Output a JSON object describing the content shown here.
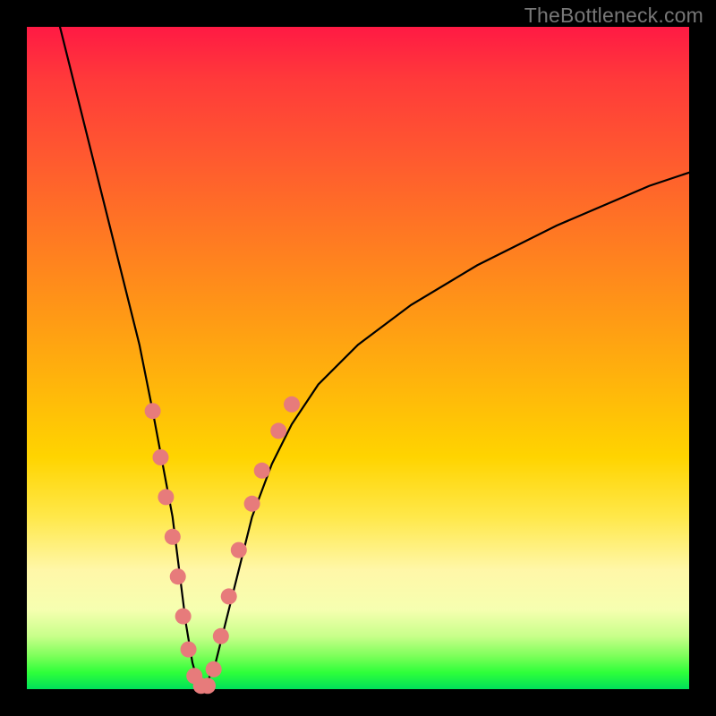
{
  "watermark": "TheBottleneck.com",
  "chart_data": {
    "type": "line",
    "title": "",
    "xlabel": "",
    "ylabel": "",
    "xlim": [
      0,
      100
    ],
    "ylim": [
      0,
      100
    ],
    "series": [
      {
        "name": "curve",
        "x": [
          5,
          8,
          11,
          14,
          17,
          19,
          20.5,
          22,
          23,
          24,
          25,
          26,
          27,
          28.5,
          30,
          32,
          34,
          37,
          40,
          44,
          50,
          58,
          68,
          80,
          94,
          100
        ],
        "y": [
          100,
          88,
          76,
          64,
          52,
          42,
          34,
          26,
          18,
          10,
          4,
          0.5,
          0.5,
          4,
          10,
          18,
          26,
          34,
          40,
          46,
          52,
          58,
          64,
          70,
          76,
          78
        ]
      }
    ],
    "markers": [
      {
        "name": "dots",
        "color": "#e77b7b",
        "radius_px": 9,
        "points": [
          {
            "x": 19.0,
            "y": 42
          },
          {
            "x": 20.2,
            "y": 35
          },
          {
            "x": 21.0,
            "y": 29
          },
          {
            "x": 22.0,
            "y": 23
          },
          {
            "x": 22.8,
            "y": 17
          },
          {
            "x": 23.6,
            "y": 11
          },
          {
            "x": 24.4,
            "y": 6
          },
          {
            "x": 25.3,
            "y": 2
          },
          {
            "x": 26.3,
            "y": 0.5
          },
          {
            "x": 27.3,
            "y": 0.5
          },
          {
            "x": 28.2,
            "y": 3
          },
          {
            "x": 29.3,
            "y": 8
          },
          {
            "x": 30.5,
            "y": 14
          },
          {
            "x": 32.0,
            "y": 21
          },
          {
            "x": 34.0,
            "y": 28
          },
          {
            "x": 35.5,
            "y": 33
          },
          {
            "x": 38.0,
            "y": 39
          },
          {
            "x": 40.0,
            "y": 43
          }
        ]
      }
    ]
  }
}
